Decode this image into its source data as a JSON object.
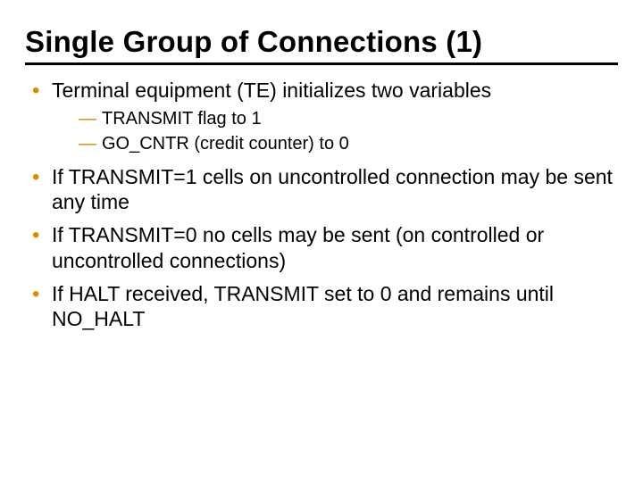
{
  "title": "Single Group of Connections (1)",
  "bullets": {
    "b1": "Terminal equipment (TE) initializes two variables",
    "b1_sub1": "TRANSMIT flag to 1",
    "b1_sub2": "GO_CNTR (credit counter) to 0",
    "b2": "If TRANSMIT=1 cells on uncontrolled connection may be sent any time",
    "b3": "If TRANSMIT=0 no cells may be sent (on controlled or uncontrolled connections)",
    "b4": "If HALT received, TRANSMIT set to 0 and remains until NO_HALT"
  }
}
